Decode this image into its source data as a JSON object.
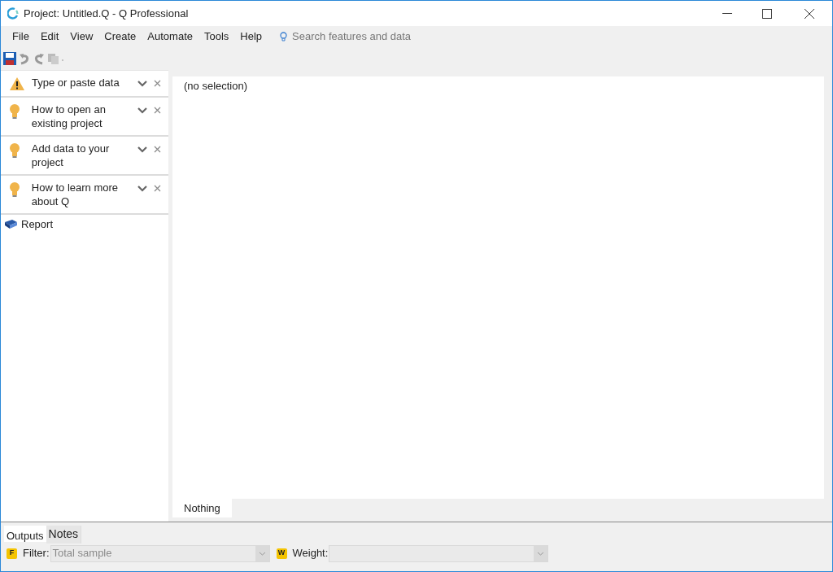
{
  "window": {
    "title": "Project: Untitled.Q - Q Professional"
  },
  "menu": [
    "File",
    "Edit",
    "View",
    "Create",
    "Automate",
    "Tools",
    "Help"
  ],
  "search": {
    "placeholder": "Search features and data"
  },
  "tips": [
    {
      "kind": "warning",
      "text": "Type or paste data"
    },
    {
      "kind": "tip",
      "text": "How to open an existing project"
    },
    {
      "kind": "tip",
      "text": "Add data to your project"
    },
    {
      "kind": "tip",
      "text": "How to learn more about Q"
    }
  ],
  "tree": [
    {
      "label": "Report"
    }
  ],
  "main": {
    "text": "(no selection)",
    "tabs": [
      {
        "label": "Nothing",
        "selected": true
      }
    ]
  },
  "bottom_tabs": [
    {
      "label": "Outputs",
      "selected": true
    },
    {
      "label": "Notes",
      "selected": false
    }
  ],
  "filter": {
    "badge": "F",
    "label": "Filter:",
    "value": "Total sample",
    "disabled": true
  },
  "weight": {
    "badge": "W",
    "label": "Weight:",
    "disabled": true
  }
}
